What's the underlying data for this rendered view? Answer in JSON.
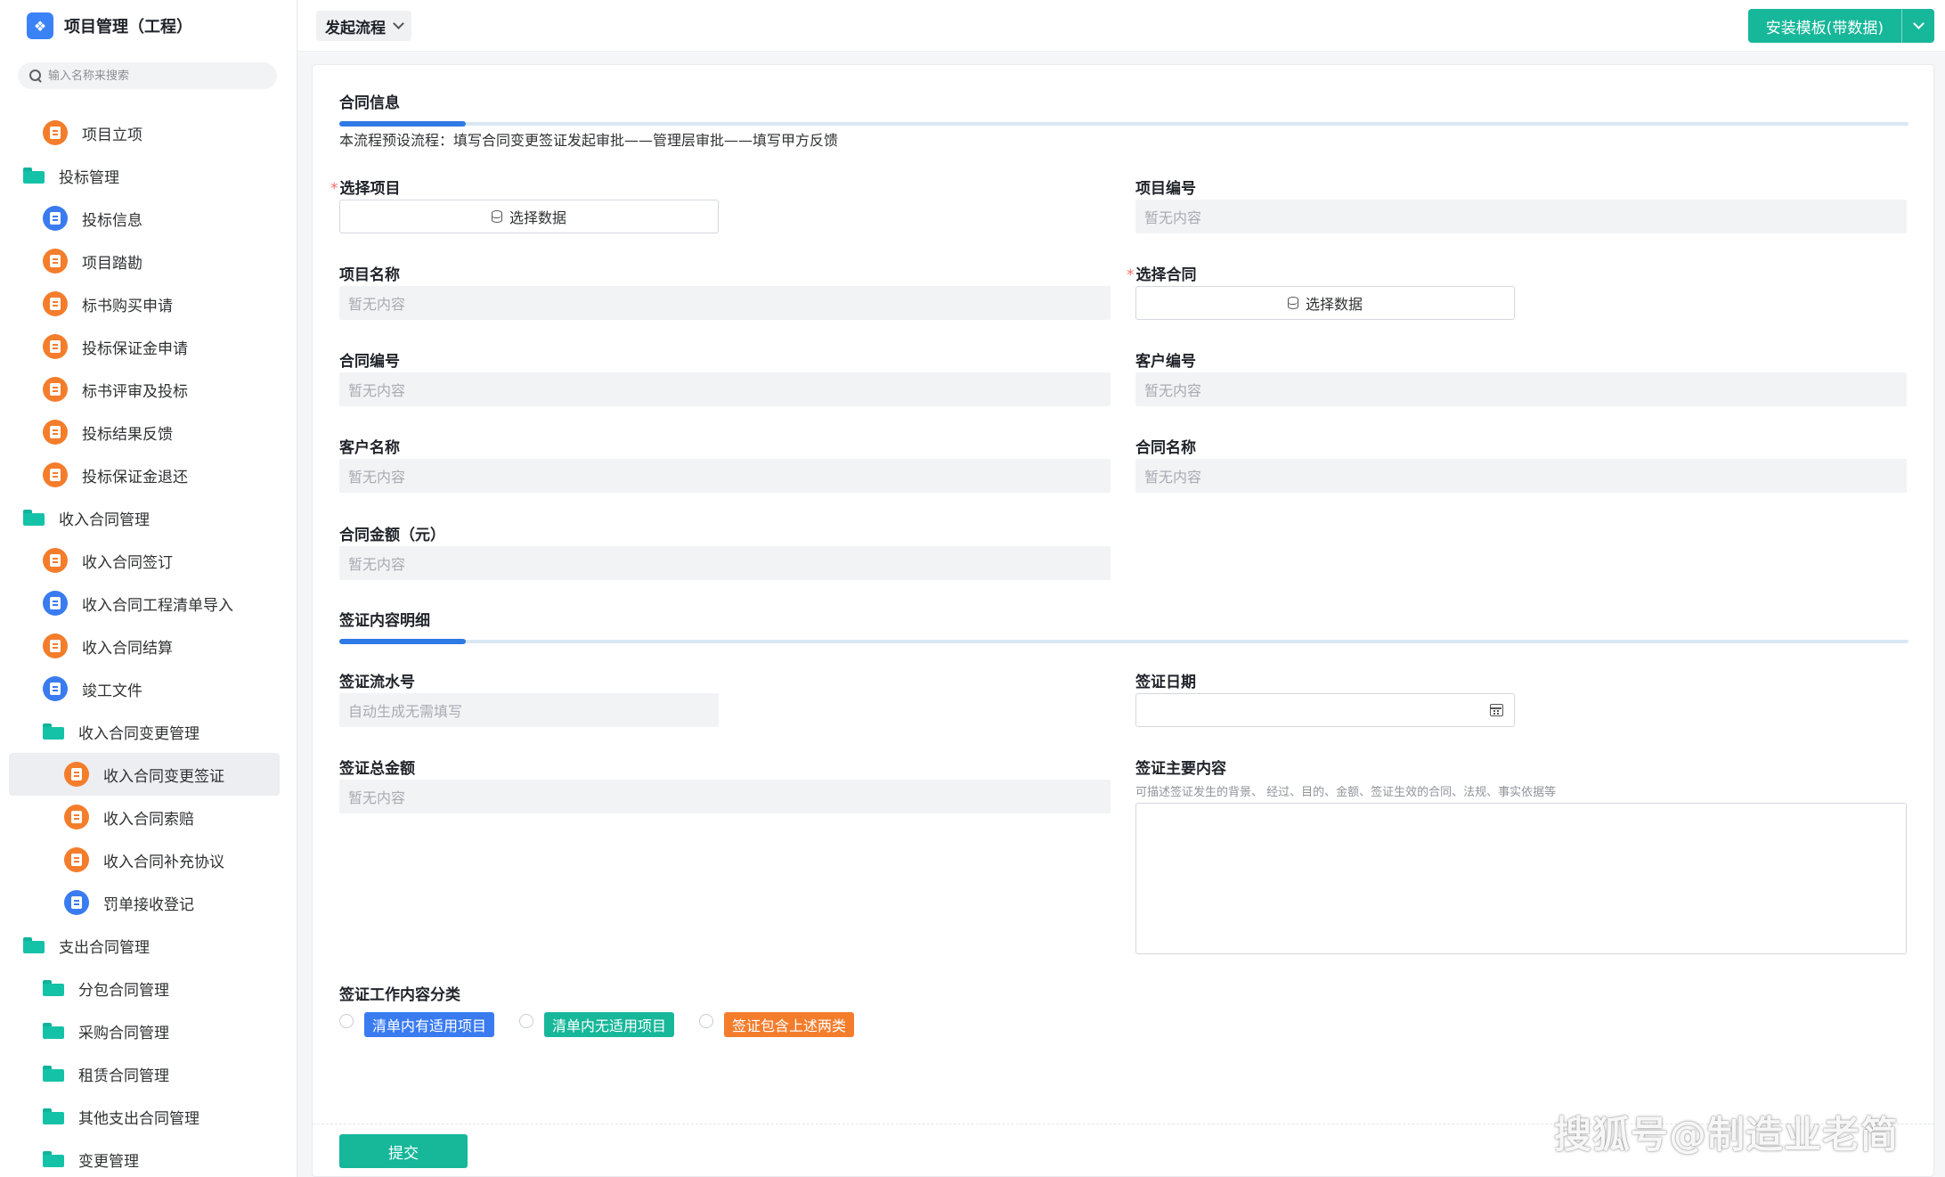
{
  "app": {
    "title": "项目管理（工程）",
    "logo_icon": "app-logo-icon"
  },
  "search": {
    "placeholder": "输入名称来搜索"
  },
  "sidebar": {
    "items": [
      {
        "label": "项目立项",
        "level": 1,
        "icon": "orange"
      },
      {
        "label": "投标管理",
        "level": 0,
        "icon": "folder"
      },
      {
        "label": "投标信息",
        "level": 1,
        "icon": "blue"
      },
      {
        "label": "项目踏勘",
        "level": 1,
        "icon": "orange"
      },
      {
        "label": "标书购买申请",
        "level": 1,
        "icon": "orange"
      },
      {
        "label": "投标保证金申请",
        "level": 1,
        "icon": "orange"
      },
      {
        "label": "标书评审及投标",
        "level": 1,
        "icon": "orange"
      },
      {
        "label": "投标结果反馈",
        "level": 1,
        "icon": "orange"
      },
      {
        "label": "投标保证金退还",
        "level": 1,
        "icon": "orange"
      },
      {
        "label": "收入合同管理",
        "level": 0,
        "icon": "folder"
      },
      {
        "label": "收入合同签订",
        "level": 1,
        "icon": "orange"
      },
      {
        "label": "收入合同工程清单导入",
        "level": 1,
        "icon": "blue"
      },
      {
        "label": "收入合同结算",
        "level": 1,
        "icon": "orange"
      },
      {
        "label": "竣工文件",
        "level": 1,
        "icon": "blue"
      },
      {
        "label": "收入合同变更管理",
        "level": 1,
        "icon": "folder"
      },
      {
        "label": "收入合同变更签证",
        "level": 2,
        "icon": "orange",
        "active": true
      },
      {
        "label": "收入合同索赔",
        "level": 2,
        "icon": "orange"
      },
      {
        "label": "收入合同补充协议",
        "level": 2,
        "icon": "orange"
      },
      {
        "label": "罚单接收登记",
        "level": 2,
        "icon": "blue"
      },
      {
        "label": "支出合同管理",
        "level": 0,
        "icon": "folder"
      },
      {
        "label": "分包合同管理",
        "level": 1,
        "icon": "folder"
      },
      {
        "label": "采购合同管理",
        "level": 1,
        "icon": "folder"
      },
      {
        "label": "租赁合同管理",
        "level": 1,
        "icon": "folder"
      },
      {
        "label": "其他支出合同管理",
        "level": 1,
        "icon": "folder"
      },
      {
        "label": "变更管理",
        "level": 1,
        "icon": "folder"
      }
    ]
  },
  "topbar": {
    "flow_button": "发起流程",
    "install_button": "安装模板(带数据)"
  },
  "form": {
    "section1_title": "合同信息",
    "flow_description": "本流程预设流程：填写合同变更签证发起审批——管理层审批——填写甲方反馈",
    "empty_text": "暂无内容",
    "select_data": "选择数据",
    "fields": {
      "select_project": "选择项目",
      "project_no": "项目编号",
      "project_name": "项目名称",
      "select_contract": "选择合同",
      "contract_no": "合同编号",
      "customer_no": "客户编号",
      "customer_name": "客户名称",
      "contract_name": "合同名称",
      "contract_amount": "合同金额（元）"
    },
    "section2_title": "签证内容明细",
    "visa": {
      "serial_label": "签证流水号",
      "serial_placeholder": "自动生成无需填写",
      "date_label": "签证日期",
      "total_label": "签证总金额",
      "content_label": "签证主要内容",
      "content_hint": "可描述签证发生的背景、 经过、目的、金额、签证生效的合同、法规、事实依据等",
      "category_label": "签证工作内容分类",
      "options": [
        "清单内有适用项目",
        "清单内无适用项目",
        "签证包含上述两类"
      ]
    },
    "submit": "提交"
  },
  "watermark": "搜狐号@制造业老简",
  "colors": {
    "accent": "#17b79a",
    "blue": "#3a7bf0",
    "orange": "#f47d2c"
  }
}
